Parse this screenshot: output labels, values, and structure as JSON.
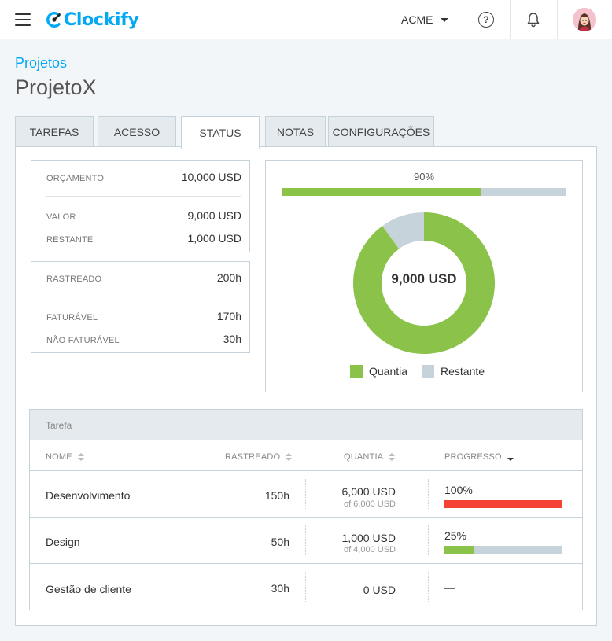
{
  "app": {
    "name": "Clockify",
    "brand_color": "#03a9f4"
  },
  "header": {
    "workspace": "ACME",
    "help_glyph": "?"
  },
  "breadcrumb": "Projetos",
  "page_title": "ProjetoX",
  "tabs": [
    {
      "label": "TAREFAS",
      "active": false
    },
    {
      "label": "ACESSO",
      "active": false
    },
    {
      "label": "STATUS",
      "active": true
    },
    {
      "label": "NOTAS",
      "active": false
    },
    {
      "label": "CONFIGURAÇÕES",
      "active": false
    }
  ],
  "budget": {
    "orcamento": {
      "label": "ORÇAMENTO",
      "value": "10,000 USD"
    },
    "valor": {
      "label": "VALOR",
      "value": "9,000 USD"
    },
    "restante": {
      "label": "RESTANTE",
      "value": "1,000 USD"
    }
  },
  "hours": {
    "rastreado": {
      "label": "RASTREADO",
      "value": "200h"
    },
    "faturavel": {
      "label": "FATURÁVEL",
      "value": "170h"
    },
    "nao_faturavel": {
      "label": "NÃO FATURÁVEL",
      "value": "30h"
    }
  },
  "budget_progress": {
    "label": "90%",
    "fraction": 0.7
  },
  "chart_data": {
    "type": "pie",
    "donut": true,
    "center_label": "9,000 USD",
    "categories": [
      "Quantia",
      "Restante"
    ],
    "values": [
      9000,
      1000
    ],
    "colors": [
      "#8bc34a",
      "#c7d3da"
    ]
  },
  "legend": {
    "quantia": "Quantia",
    "restante": "Restante"
  },
  "table": {
    "group_title": "Tarefa",
    "columns": {
      "nome": "NOME",
      "rastreado": "RASTREADO",
      "quantia": "QUANTIA",
      "progresso": "PROGRESSO"
    },
    "rows": [
      {
        "name": "Desenvolvimento",
        "tracked": "150h",
        "amount": "6,000 USD",
        "of": "of 6,000 USD",
        "progress_label": "100%",
        "progress": 1.0,
        "color": "#f44336"
      },
      {
        "name": "Design",
        "tracked": "50h",
        "amount": "1,000 USD",
        "of": "of 4,000 USD",
        "progress_label": "25%",
        "progress": 0.25,
        "color": "#8bc34a"
      },
      {
        "name": "Gestão de cliente",
        "tracked": "30h",
        "amount": "0 USD",
        "of": "",
        "progress_label": "—",
        "progress": null,
        "color": ""
      }
    ]
  }
}
